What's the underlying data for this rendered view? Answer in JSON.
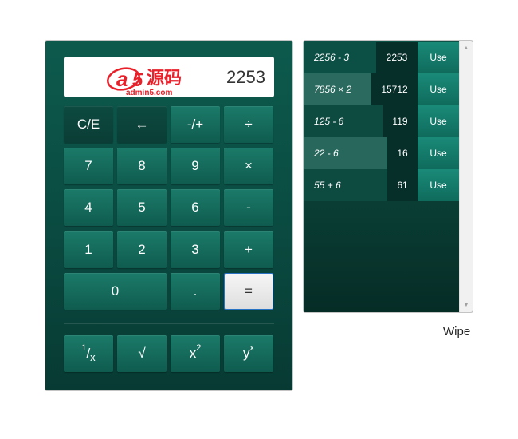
{
  "display": {
    "logo_text": "源码",
    "logo_subtext": "admin5.com",
    "value": "2253"
  },
  "keys": {
    "clear": "C/E",
    "backspace": "←",
    "negate": "-/+",
    "divide": "÷",
    "seven": "7",
    "eight": "8",
    "nine": "9",
    "multiply": "×",
    "four": "4",
    "five": "5",
    "six": "6",
    "subtract": "-",
    "one": "1",
    "two": "2",
    "three": "3",
    "add": "+",
    "zero": "0",
    "decimal": ".",
    "equals": "=",
    "reciprocal_num": "1",
    "reciprocal_slash": "/",
    "reciprocal_x": "x",
    "sqrt": "√",
    "square_base": "x",
    "square_exp": "2",
    "power_base": "y",
    "power_exp": "x"
  },
  "history": [
    {
      "expr": "2256 - 3",
      "result": "2253",
      "action": "Use"
    },
    {
      "expr": "7856 × 2",
      "result": "15712",
      "action": "Use"
    },
    {
      "expr": "125 - 6",
      "result": "119",
      "action": "Use"
    },
    {
      "expr": "22 - 6",
      "result": "16",
      "action": "Use"
    },
    {
      "expr": "55 + 6",
      "result": "61",
      "action": "Use"
    }
  ],
  "wipe_label": "Wipe",
  "colors": {
    "calc_bg": "#0b5146",
    "key": "#157060",
    "use_button": "#148070",
    "logo_red": "#e8202a",
    "equals_border": "#2a72c4"
  }
}
